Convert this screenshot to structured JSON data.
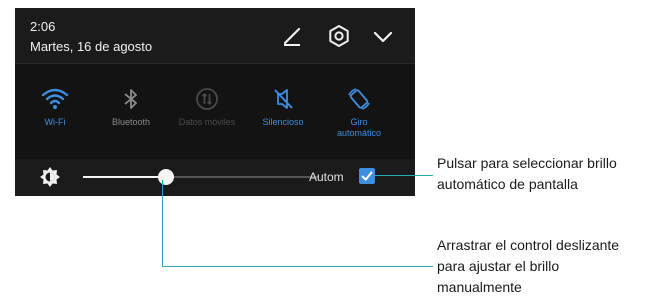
{
  "status": {
    "time": "2:06",
    "date": "Martes, 16 de agosto"
  },
  "header_icons": [
    "edit-icon",
    "settings-gear-icon",
    "chevron-down-icon"
  ],
  "tiles": [
    {
      "name": "wifi",
      "label": "Wi-Fi",
      "icon": "wifi-icon",
      "active": true
    },
    {
      "name": "bluetooth",
      "label": "Bluetooth",
      "icon": "bluetooth-icon",
      "active": false
    },
    {
      "name": "datos-moviles",
      "label": "Datos móviles",
      "icon": "mobile-data-icon",
      "active": false,
      "disabled": true
    },
    {
      "name": "silencioso",
      "label": "Silencioso",
      "icon": "silent-mode-icon",
      "active": true
    },
    {
      "name": "giro-automatico",
      "label_line1": "Giro",
      "label_line2": "automático",
      "icon": "auto-rotate-icon",
      "active": true
    }
  ],
  "brightness": {
    "icon": "brightness-icon",
    "level": 0.35,
    "auto_label": "Autom",
    "auto_checked": true
  },
  "annotations": {
    "auto_line1": "Pulsar para seleccionar brillo",
    "auto_line2": "automático de pantalla",
    "slider_line1": "Arrastrar el control deslizante",
    "slider_line2": "para ajustar el brillo",
    "slider_line3": "manualmente"
  },
  "colors": {
    "active": "#3d8fe0",
    "inactive": "#8a8a8a",
    "disabled": "#4a4a4a",
    "callout_line": "#22aab8"
  }
}
